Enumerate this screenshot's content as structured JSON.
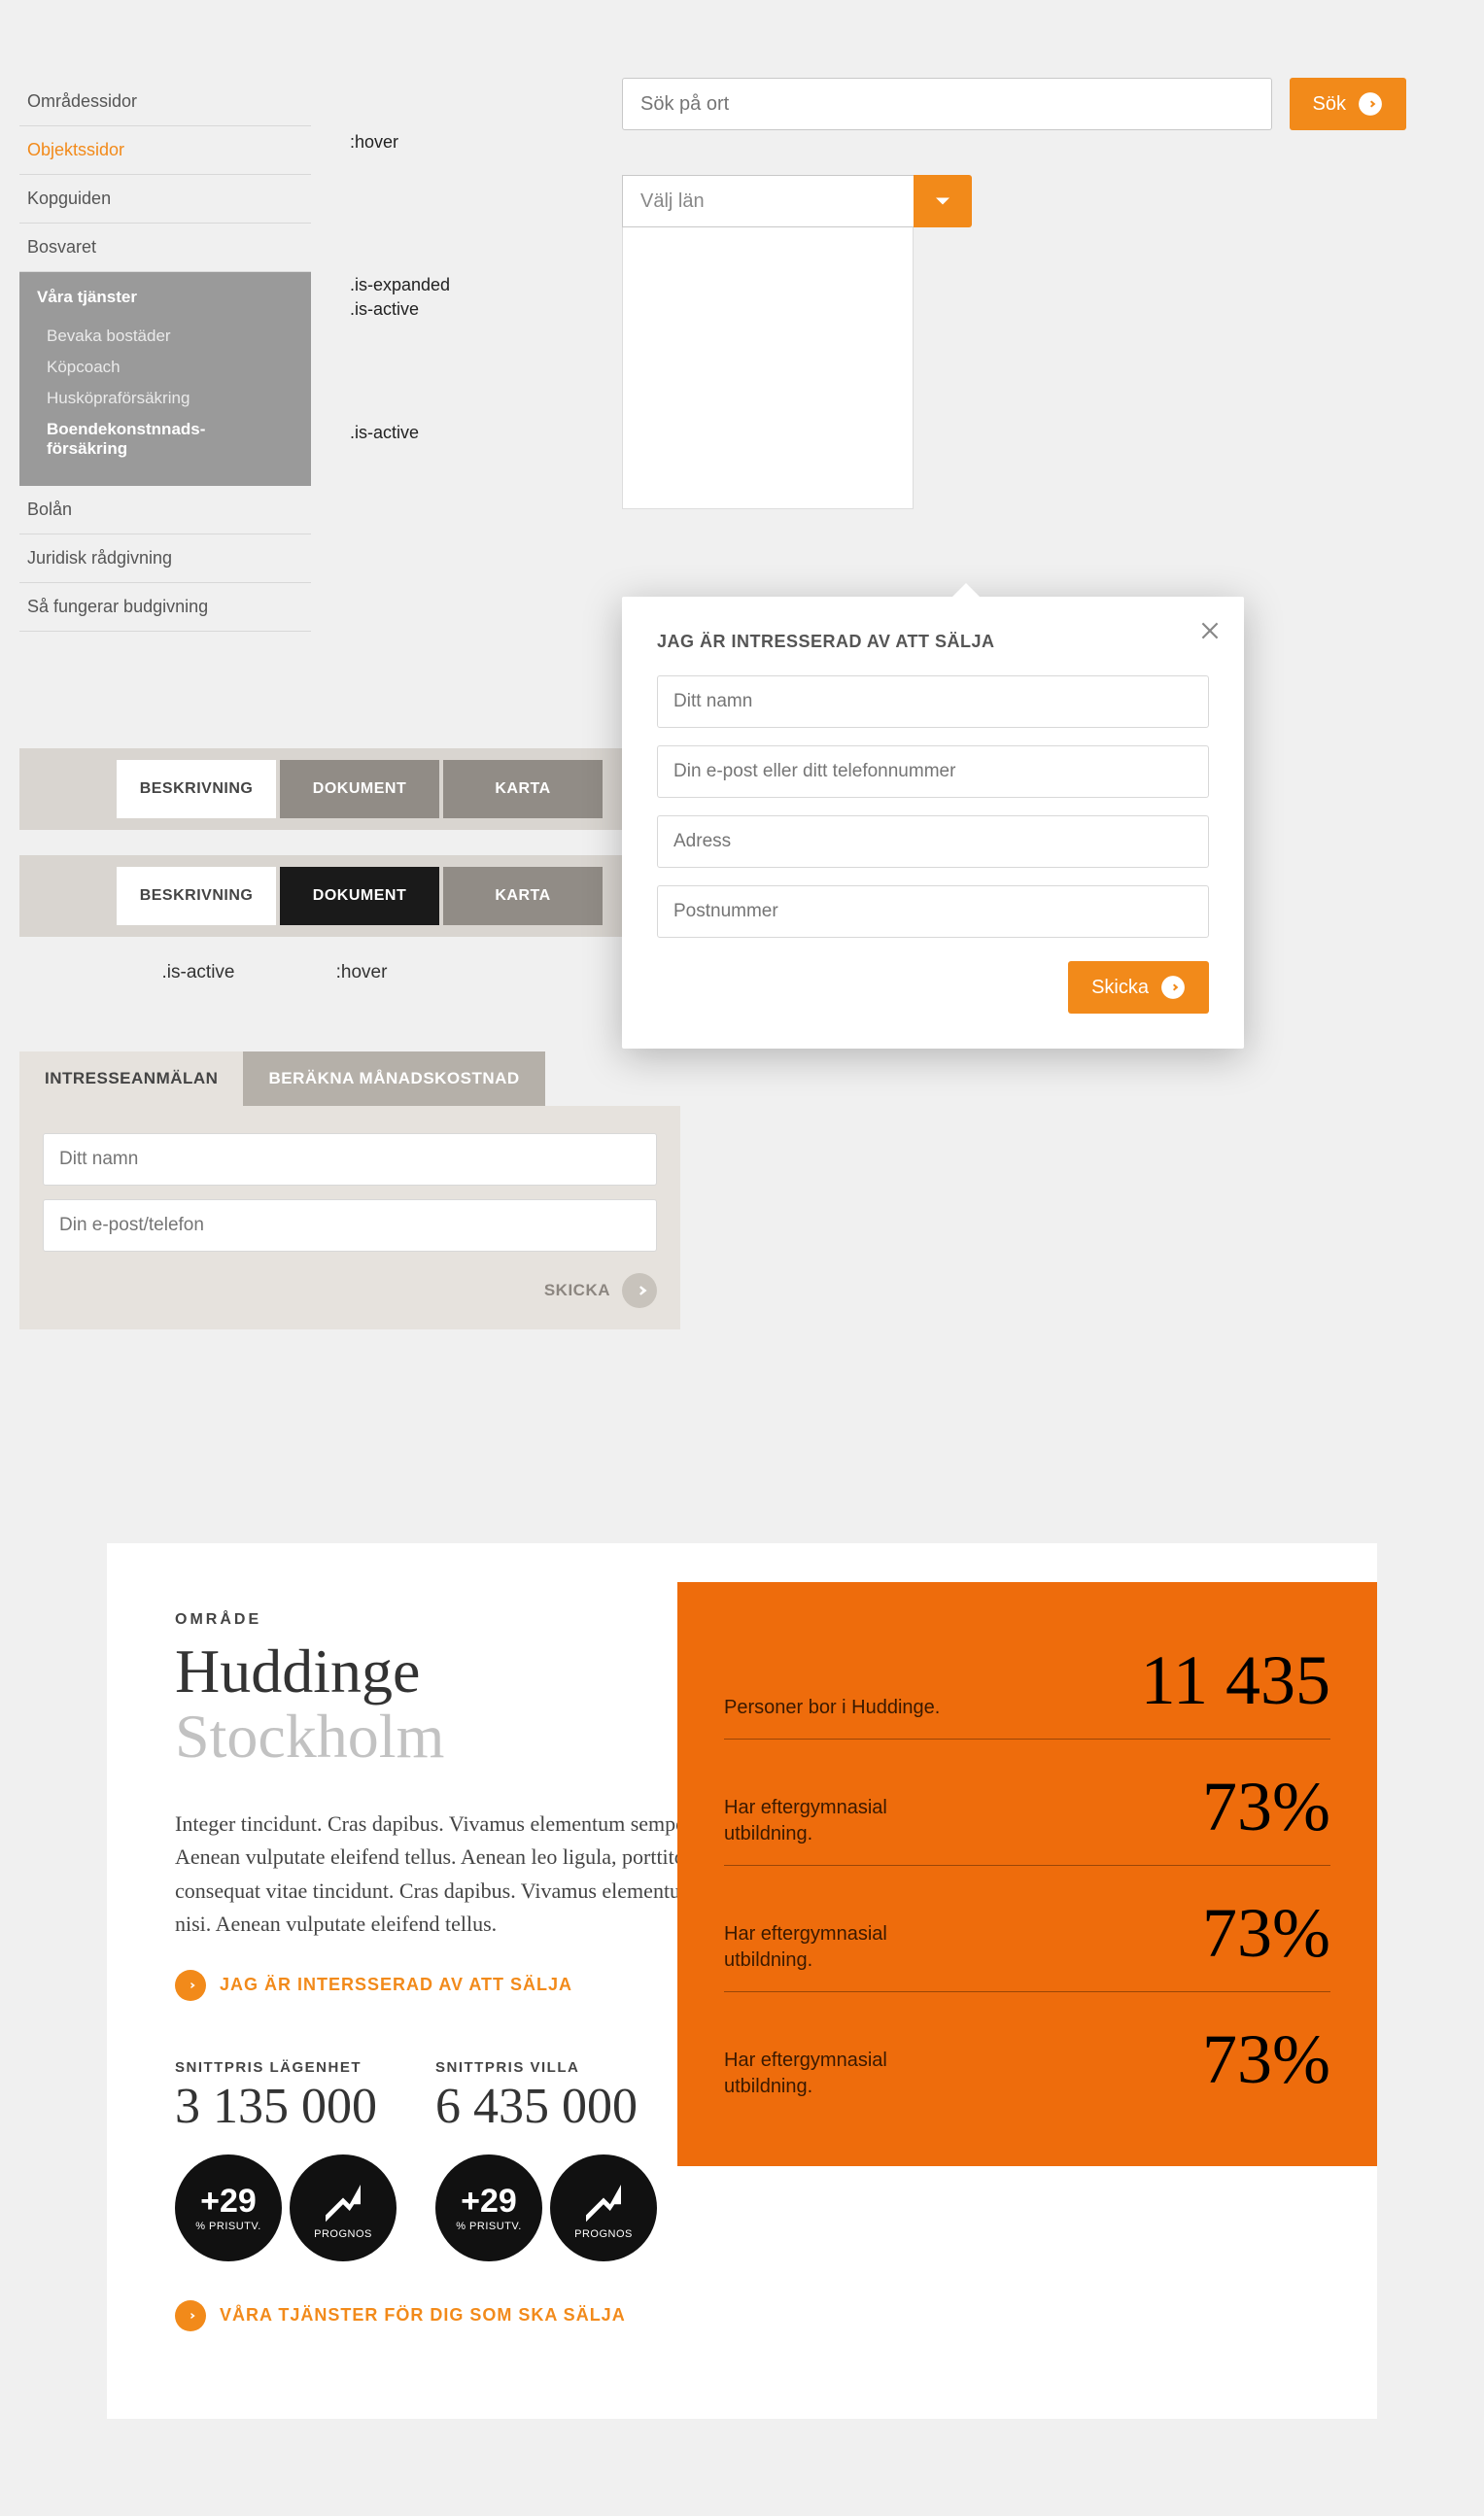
{
  "sidebar": {
    "items": [
      {
        "label": "Områdessidor"
      },
      {
        "label": "Objektssidor",
        "state": ":hover"
      },
      {
        "label": "Kopguiden"
      },
      {
        "label": "Bosvaret"
      }
    ],
    "group": {
      "title": "Våra tjänster",
      "state_a": ".is-expanded",
      "state_b": ".is-active",
      "items": [
        {
          "label": "Bevaka bostäder"
        },
        {
          "label": "Köpcoach"
        },
        {
          "label": "Husköpraförsäkring"
        },
        {
          "label": "Boendekonstnnads-försäkring",
          "state": ".is-active"
        }
      ]
    },
    "items2": [
      {
        "label": "Bolån"
      },
      {
        "label": "Juridisk rådgivning"
      },
      {
        "label": "Så fungerar budgivning"
      }
    ]
  },
  "search": {
    "placeholder": "Sök på ort",
    "button": "Sök"
  },
  "dropdown": {
    "label": "Välj län"
  },
  "popover": {
    "title": "JAG ÄR INTRESSERAD AV ATT SÄLJA",
    "fields": {
      "name": "Ditt namn",
      "contact": "Din e-post eller ditt telefonnummer",
      "address": "Adress",
      "zip": "Postnummer"
    },
    "submit": "Skicka"
  },
  "tabs": {
    "a": "BESKRIVNING",
    "b": "DOKUMENT",
    "c": "KARTA",
    "lbl_active": ".is-active",
    "lbl_hover": ":hover"
  },
  "interest": {
    "tab_a": "INTRESSEANMÄLAN",
    "tab_b": "BERÄKNA MÅNADSKOSTNAD",
    "name_ph": "Ditt namn",
    "contact_ph": "Din e-post/telefon",
    "submit": "SKICKA"
  },
  "area": {
    "kicker": "OMRÅDE",
    "title": "Huddinge",
    "subtitle": "Stockholm",
    "desc": "Integer tincidunt. Cras dapibus. Vivamus elementum semper nisi. Aenean vulputate eleifend tellus. Aenean leo ligula, porttitor eu, consequat vitae tincidunt. Cras dapibus. Vivamus elementum semper nisi. Aenean vulputate eleifend tellus.",
    "link1": "JAG ÄR INTERSSERAD AV ATT SÄLJA",
    "link2": "VÅRA TJÄNSTER FÖR DIG SOM SKA SÄLJA",
    "price1_label": "SNITTPRIS LÄGENHET",
    "price1_val": "3 135 000",
    "price2_label": "SNITTPRIS VILLA",
    "price2_val": "6 435 000",
    "badge_val": "+29",
    "badge_sub": "% PRISUTV.",
    "badge_prog": "PROGNOS",
    "stats": [
      {
        "label": "Personer bor i Huddinge.",
        "value": "11 435"
      },
      {
        "label": "Har eftergymnasial utbildning.",
        "value": "73%"
      },
      {
        "label": "Har eftergymnasial utbildning.",
        "value": "73%"
      },
      {
        "label": "Har eftergymnasial utbildning.",
        "value": "73%"
      }
    ]
  }
}
